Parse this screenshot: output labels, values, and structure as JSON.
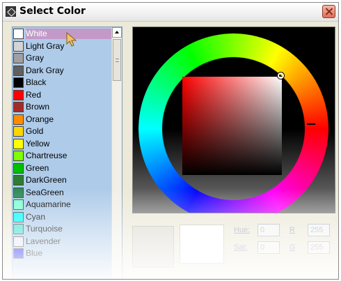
{
  "window": {
    "title": "Select Color",
    "icon": "color-picker-app-icon",
    "close_icon": "close-icon"
  },
  "color_list": {
    "selected": "White",
    "items": [
      {
        "label": "White",
        "color": "#ffffff"
      },
      {
        "label": "Light Gray",
        "color": "#d4d4d4"
      },
      {
        "label": "Gray",
        "color": "#a0a0a0"
      },
      {
        "label": "Dark Gray",
        "color": "#606060"
      },
      {
        "label": "Black",
        "color": "#000000"
      },
      {
        "label": "Red",
        "color": "#ff0000"
      },
      {
        "label": "Brown",
        "color": "#a52a2a"
      },
      {
        "label": "Orange",
        "color": "#ff8c00"
      },
      {
        "label": "Gold",
        "color": "#ffd700"
      },
      {
        "label": "Yellow",
        "color": "#ffff00"
      },
      {
        "label": "Chartreuse",
        "color": "#7fff00"
      },
      {
        "label": "Green",
        "color": "#00c000"
      },
      {
        "label": "DarkGreen",
        "color": "#2e7d32"
      },
      {
        "label": "SeaGreen",
        "color": "#2e8b57"
      },
      {
        "label": "Aquamarine",
        "color": "#7fffd4"
      },
      {
        "label": "Cyan",
        "color": "#00ffff"
      },
      {
        "label": "Turquoise",
        "color": "#40e0d0"
      },
      {
        "label": "Lavender",
        "color": "#e6e6fa"
      },
      {
        "label": "Blue",
        "color": "#0000ff"
      }
    ]
  },
  "picker": {
    "hue_ring": "hue-ring",
    "selected_hue": "Red"
  },
  "fields": {
    "hue_label": "Hue:",
    "hue_value": "0",
    "sat_label": "Sat:",
    "sat_value": "0",
    "r_label": "R",
    "r_value": "255",
    "g_label": "G",
    "g_value": "255"
  },
  "colors": {
    "list_background": "#aecbe9",
    "selection": "#c39ac7",
    "window": "#ece9d8"
  }
}
